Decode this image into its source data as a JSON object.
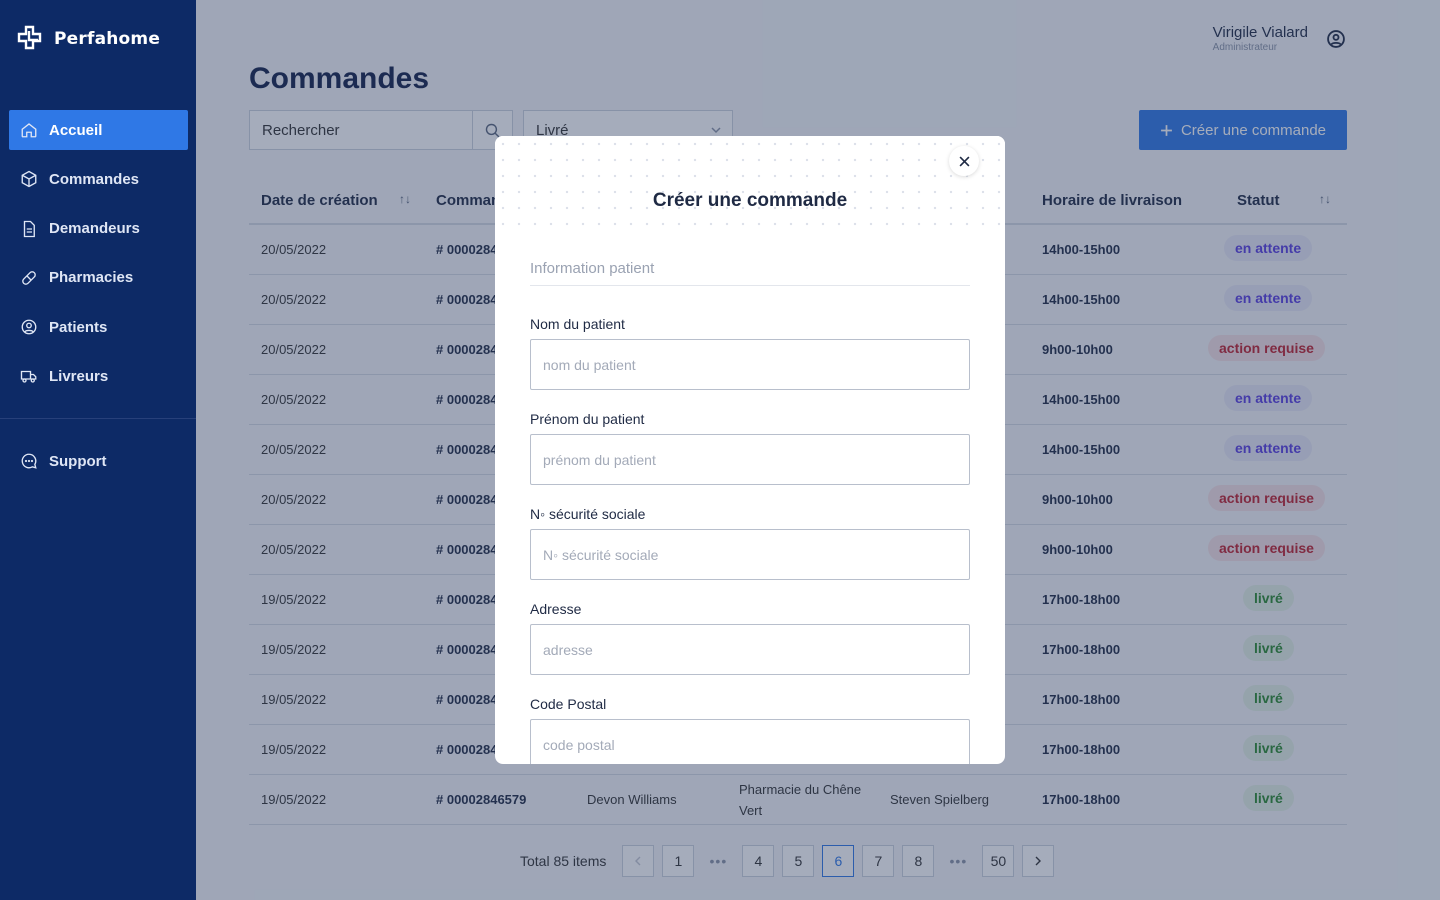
{
  "brand": "Perfahome",
  "nav": [
    {
      "label": "Accueil",
      "icon": "home-icon",
      "active": true
    },
    {
      "label": "Commandes",
      "icon": "package-icon"
    },
    {
      "label": "Demandeurs",
      "icon": "document-icon"
    },
    {
      "label": "Pharmacies",
      "icon": "pill-icon"
    },
    {
      "label": "Patients",
      "icon": "user-circle-icon"
    },
    {
      "label": "Livreurs",
      "icon": "truck-icon"
    }
  ],
  "support": {
    "label": "Support",
    "icon": "chat-icon"
  },
  "user": {
    "name": "Virigile Vialard",
    "role": "Administrateur"
  },
  "page_title": "Commandes",
  "search": {
    "placeholder": "Rechercher"
  },
  "status_filter": {
    "value": "Livré"
  },
  "create_button": "Créer une commande",
  "table": {
    "headers": {
      "date": "Date de création",
      "commande": "Commande",
      "horaire": "Horaire de livraison",
      "statut": "Statut"
    },
    "rows": [
      {
        "date": "20/05/2022",
        "num": "# 0000284",
        "horaire": "14h00-15h00",
        "statut": "en attente",
        "kind": "attente"
      },
      {
        "date": "20/05/2022",
        "num": "# 0000284",
        "horaire": "14h00-15h00",
        "statut": "en attente",
        "kind": "attente"
      },
      {
        "date": "20/05/2022",
        "num": "# 0000284",
        "horaire": "9h00-10h00",
        "statut": "action requise",
        "kind": "action"
      },
      {
        "date": "20/05/2022",
        "num": "# 0000284",
        "horaire": "14h00-15h00",
        "statut": "en attente",
        "kind": "attente"
      },
      {
        "date": "20/05/2022",
        "num": "# 0000284",
        "horaire": "14h00-15h00",
        "statut": "en attente",
        "kind": "attente"
      },
      {
        "date": "20/05/2022",
        "num": "# 0000284",
        "horaire": "9h00-10h00",
        "statut": "action requise",
        "kind": "action"
      },
      {
        "date": "20/05/2022",
        "num": "# 0000284",
        "horaire": "9h00-10h00",
        "statut": "action requise",
        "kind": "action"
      },
      {
        "date": "19/05/2022",
        "num": "# 0000284",
        "horaire": "17h00-18h00",
        "statut": "livré",
        "kind": "livre"
      },
      {
        "date": "19/05/2022",
        "num": "# 0000284",
        "horaire": "17h00-18h00",
        "statut": "livré",
        "kind": "livre"
      },
      {
        "date": "19/05/2022",
        "num": "# 0000284",
        "horaire": "17h00-18h00",
        "statut": "livré",
        "kind": "livre"
      },
      {
        "date": "19/05/2022",
        "num": "# 0000284",
        "horaire": "17h00-18h00",
        "statut": "livré",
        "kind": "livre"
      },
      {
        "date": "19/05/2022",
        "num": "# 00002846579",
        "demandeur": "Devon Williams",
        "pharmacie": "Pharmacie du Chêne Vert",
        "livreur": "Steven Spielberg",
        "horaire": "17h00-18h00",
        "statut": "livré",
        "kind": "livre"
      }
    ]
  },
  "pagination": {
    "total": "Total 85 items",
    "pages": [
      "1",
      "4",
      "5",
      "6",
      "7",
      "8",
      "50"
    ],
    "current": "6",
    "ellipsis": "•••"
  },
  "modal": {
    "title": "Créer une commande",
    "section": "Information patient",
    "fields": [
      {
        "label": "Nom du patient",
        "placeholder": "nom du patient"
      },
      {
        "label": "Prénom du patient",
        "placeholder": "prénom du patient"
      },
      {
        "label": "N◦ sécurité sociale",
        "placeholder": "N◦ sécurité sociale"
      },
      {
        "label": "Adresse",
        "placeholder": "adresse"
      },
      {
        "label": "Code Postal",
        "placeholder": "code postal"
      }
    ]
  },
  "colors": {
    "sidebar": "#0d2a66",
    "accent": "#2f78e6",
    "attente": "#5a3ee0",
    "action": "#c0222f",
    "livre": "#2c8a2f"
  }
}
